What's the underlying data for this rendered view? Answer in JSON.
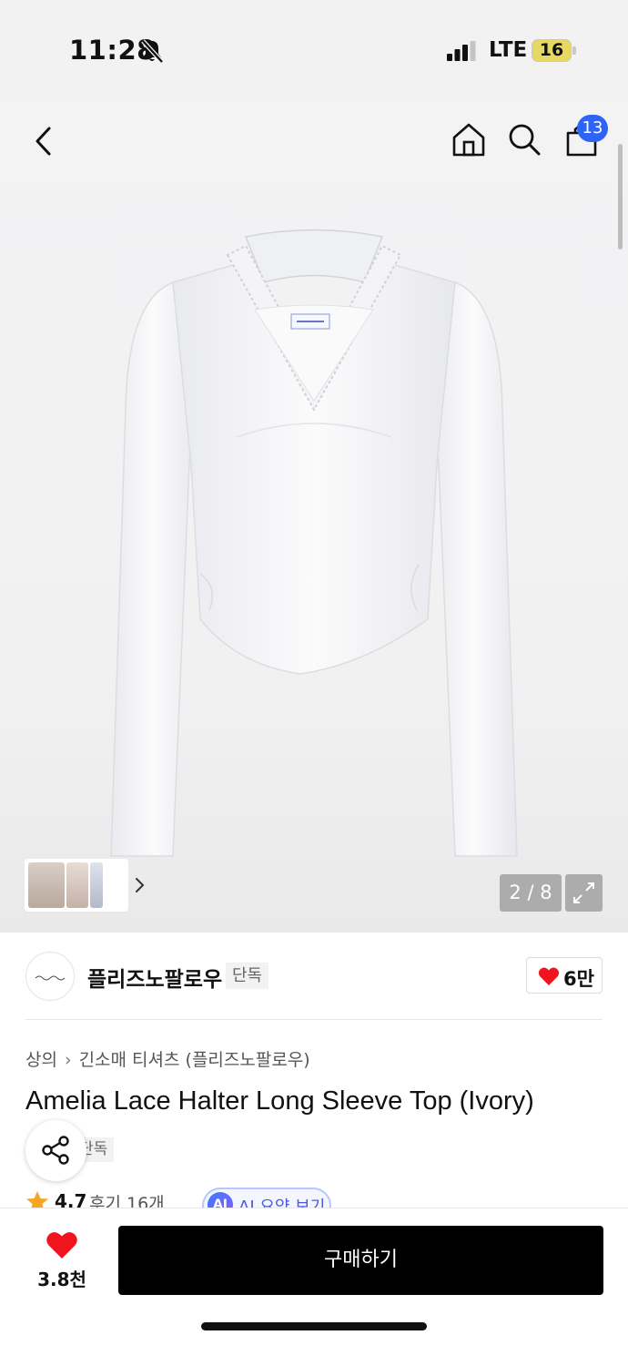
{
  "status_bar": {
    "time": "11:28",
    "network": "LTE",
    "battery": "16",
    "bell_icon": "bell-slash-icon"
  },
  "nav": {
    "back_icon": "chevron-left-icon",
    "home_icon": "home-icon",
    "search_icon": "search-icon",
    "cart_icon": "shopping-bag-icon",
    "cart_count": "13"
  },
  "gallery": {
    "page_indicator": "2 / 8",
    "expand_icon": "expand-icon",
    "thumbs_arrow_icon": "chevron-right-icon"
  },
  "brand": {
    "name": "플리즈노팔로우",
    "tag": "단독",
    "likes": "6만"
  },
  "product": {
    "breadcrumb": [
      "상의",
      "긴소매 티셔츠 (플리즈노팔로우)"
    ],
    "title": "Amelia Lace Halter Long Sleeve Top (Ivory)",
    "exclusive_tag": "단독",
    "rating": "4.7",
    "reviews": "후기 16개",
    "ai_badge": "AI",
    "ai_summary": "AI 요약 보기"
  },
  "bottom_bar": {
    "wishlist_count": "3.8천",
    "buy_label": "구매하기"
  },
  "colors": {
    "accent_blue": "#2d64f5",
    "heart_red": "#f0141e",
    "buy_button": "#000000"
  }
}
